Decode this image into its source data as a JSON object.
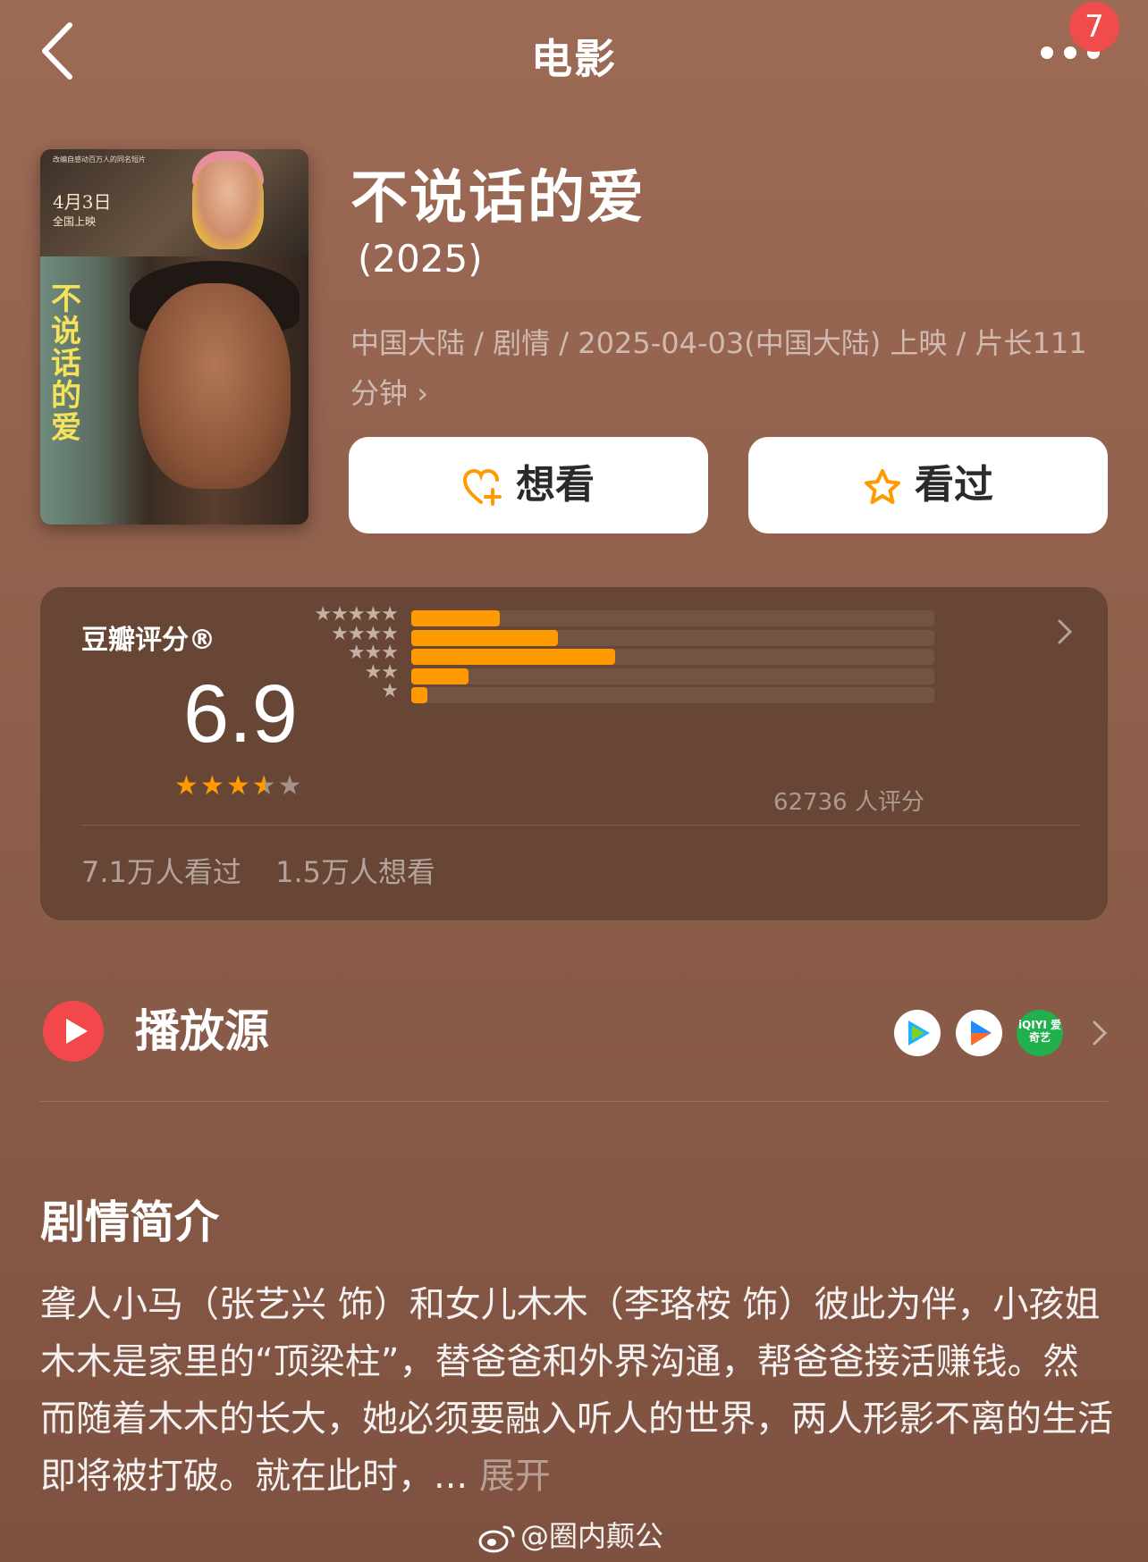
{
  "nav": {
    "title": "电影",
    "badge_count": "7"
  },
  "movie": {
    "title": "不说话的爱",
    "year": "(2025)",
    "meta": "中国大陆 / 剧情 / 2025-04-03(中国大陆) 上映 / 片长111分钟",
    "meta_chevron": "›",
    "poster": {
      "date": "4月3日",
      "release": "全国上映",
      "tagline": "改编自感动百万人的同名短片",
      "calligraphy": "不说话的爱"
    }
  },
  "actions": {
    "want_label": "想看",
    "seen_label": "看过"
  },
  "rating": {
    "label": "豆瓣评分®",
    "score": "6.9",
    "score_stars": 3.5,
    "distribution": [
      {
        "stars": "★★★★★",
        "fraction": 0.17
      },
      {
        "stars": "★★★★",
        "fraction": 0.28
      },
      {
        "stars": "★★★",
        "fraction": 0.39
      },
      {
        "stars": "★★",
        "fraction": 0.11
      },
      {
        "stars": "★",
        "fraction": 0.03
      }
    ],
    "count_text": "62736 人评分",
    "watched": "7.1万人看过",
    "want": "1.5万人想看"
  },
  "play_source": {
    "label": "播放源",
    "sources": [
      "tencent-video-icon",
      "youku-icon",
      "iqiyi-icon"
    ],
    "iqiyi_text": "iQIYI 爱奇艺"
  },
  "synopsis": {
    "title": "剧情简介",
    "text": "聋人小马（张艺兴 饰）和女儿木木（李珞桉 饰）彼此为伴，小孩姐木木是家里的“顶梁柱”，替爸爸和外界沟通，帮爸爸接活赚钱。然而随着木木的长大，她必须要融入听人的世界，两人形影不离的生活即将被打破。就在此时，...",
    "expand": "展开"
  },
  "watermark": "@圈内颠公",
  "colors": {
    "accent": "#ff9a00",
    "badge": "#f14c4c",
    "play": "#f2484c",
    "card": "#674636"
  }
}
